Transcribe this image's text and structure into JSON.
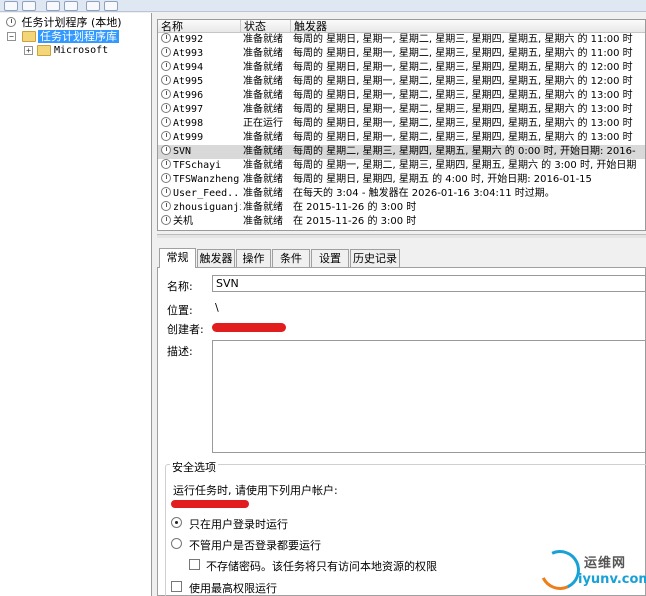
{
  "tree": {
    "root_label": "任务计划程序 (本地)",
    "library_label": "任务计划程序库",
    "child_label": "Microsoft",
    "expand_symbol": "+",
    "collapse_symbol": "−"
  },
  "grid": {
    "columns": [
      "名称",
      "状态",
      "触发器"
    ],
    "rows": [
      {
        "name": "At992",
        "status": "准备就绪",
        "trigger": "每周的 星期日, 星期一, 星期二, 星期三, 星期四, 星期五, 星期六 的 11:00 时"
      },
      {
        "name": "At993",
        "status": "准备就绪",
        "trigger": "每周的 星期日, 星期一, 星期二, 星期三, 星期四, 星期五, 星期六 的 11:00 时"
      },
      {
        "name": "At994",
        "status": "准备就绪",
        "trigger": "每周的 星期日, 星期一, 星期二, 星期三, 星期四, 星期五, 星期六 的 12:00 时"
      },
      {
        "name": "At995",
        "status": "准备就绪",
        "trigger": "每周的 星期日, 星期一, 星期二, 星期三, 星期四, 星期五, 星期六 的 12:00 时"
      },
      {
        "name": "At996",
        "status": "准备就绪",
        "trigger": "每周的 星期日, 星期一, 星期二, 星期三, 星期四, 星期五, 星期六 的 13:00 时"
      },
      {
        "name": "At997",
        "status": "准备就绪",
        "trigger": "每周的 星期日, 星期一, 星期二, 星期三, 星期四, 星期五, 星期六 的 13:00 时"
      },
      {
        "name": "At998",
        "status": "正在运行",
        "trigger": "每周的 星期日, 星期一, 星期二, 星期三, 星期四, 星期五, 星期六 的 13:00 时"
      },
      {
        "name": "At999",
        "status": "准备就绪",
        "trigger": "每周的 星期日, 星期一, 星期二, 星期三, 星期四, 星期五, 星期六 的 13:00 时"
      },
      {
        "name": "SVN",
        "status": "准备就绪",
        "trigger": "每周的 星期二, 星期三, 星期四, 星期五, 星期六 的 0:00 时, 开始日期: 2016-",
        "selected": true
      },
      {
        "name": "TFSchayi",
        "status": "准备就绪",
        "trigger": "每周的 星期一, 星期二, 星期三, 星期四, 星期五, 星期六 的 3:00 时, 开始日期"
      },
      {
        "name": "TFSWanzheng",
        "status": "准备就绪",
        "trigger": "每周的 星期日, 星期四, 星期五 的 4:00 时, 开始日期: 2016-01-15"
      },
      {
        "name": "User_Feed...",
        "status": "准备就绪",
        "trigger": "在每天的 3:04 - 触发器在 2026-01-16 3:04:11 时过期。"
      },
      {
        "name": "zhousiguanji",
        "status": "准备就绪",
        "trigger": "在 2015-11-26 的 3:00 时"
      },
      {
        "name": "关机",
        "status": "准备就绪",
        "trigger": "在 2015-11-26 的 3:00 时"
      }
    ]
  },
  "tabs": [
    "常规",
    "触发器",
    "操作",
    "条件",
    "设置",
    "历史记录"
  ],
  "general": {
    "name_label": "名称:",
    "name_value": "SVN",
    "location_label": "位置:",
    "location_value": "\\",
    "author_label": "创建者:",
    "description_label": "描述:"
  },
  "security": {
    "title": "安全选项",
    "run_as_label": "运行任务时, 请使用下列用户帐户:",
    "radio_logged_on": "只在用户登录时运行",
    "radio_whether": "不管用户是否登录都要运行",
    "no_store_password": "不存储密码。该任务将只有访问本地资源的权限",
    "highest_privileges": "使用最高权限运行"
  },
  "watermark": {
    "cn": "运维网",
    "url": "iyunv.com"
  },
  "colors": {
    "selection_blue": "#3399ff",
    "selected_row": "#d9d9d9",
    "redaction_red": "#e21d1d"
  }
}
